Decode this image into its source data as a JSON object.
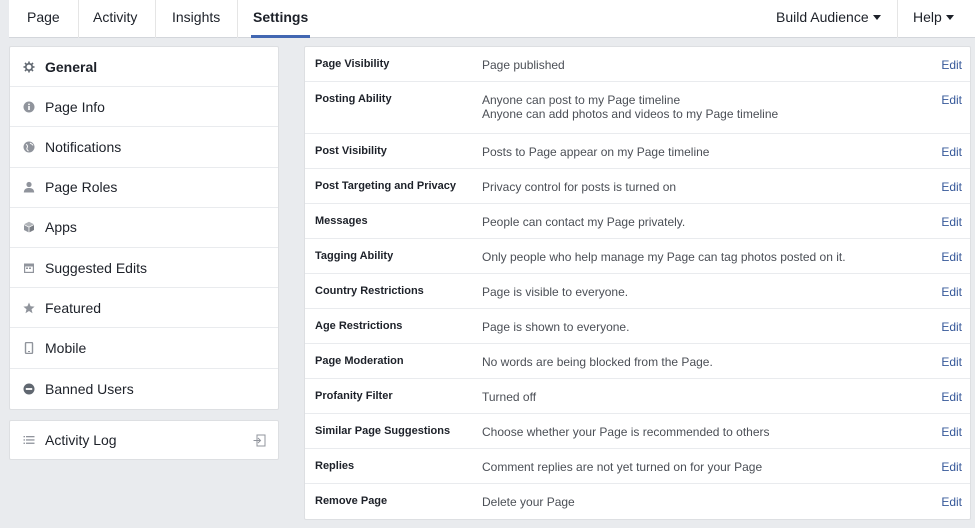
{
  "topnav": {
    "tabs": [
      {
        "label": "Page"
      },
      {
        "label": "Activity"
      },
      {
        "label": "Insights"
      },
      {
        "label": "Settings"
      }
    ],
    "build_audience": "Build Audience",
    "help": "Help"
  },
  "sidebar": {
    "items": [
      {
        "label": "General",
        "icon": "gear-icon"
      },
      {
        "label": "Page Info",
        "icon": "info-icon"
      },
      {
        "label": "Notifications",
        "icon": "globe-icon"
      },
      {
        "label": "Page Roles",
        "icon": "person-icon"
      },
      {
        "label": "Apps",
        "icon": "cube-icon"
      },
      {
        "label": "Suggested Edits",
        "icon": "calendar-icon"
      },
      {
        "label": "Featured",
        "icon": "star-icon"
      },
      {
        "label": "Mobile",
        "icon": "phone-icon"
      },
      {
        "label": "Banned Users",
        "icon": "minus-circle-icon"
      }
    ],
    "activity_log": "Activity Log"
  },
  "settings": {
    "edit_label": "Edit",
    "rows": [
      {
        "name": "Page Visibility",
        "value": "Page published"
      },
      {
        "name": "Posting Ability",
        "value": "Anyone can post to my Page timeline",
        "value2": "Anyone can add photos and videos to my Page timeline"
      },
      {
        "name": "Post Visibility",
        "value": "Posts to Page appear on my Page timeline"
      },
      {
        "name": "Post Targeting and Privacy",
        "value": "Privacy control for posts is turned on"
      },
      {
        "name": "Messages",
        "value": "People can contact my Page privately."
      },
      {
        "name": "Tagging Ability",
        "value": "Only people who help manage my Page can tag photos posted on it."
      },
      {
        "name": "Country Restrictions",
        "value": "Page is visible to everyone."
      },
      {
        "name": "Age Restrictions",
        "value": "Page is shown to everyone."
      },
      {
        "name": "Page Moderation",
        "value": "No words are being blocked from the Page."
      },
      {
        "name": "Profanity Filter",
        "value": "Turned off"
      },
      {
        "name": "Similar Page Suggestions",
        "value": "Choose whether your Page is recommended to others"
      },
      {
        "name": "Replies",
        "value": "Comment replies are not yet turned on for your Page"
      },
      {
        "name": "Remove Page",
        "value": "Delete your Page"
      }
    ]
  },
  "colors": {
    "accent": "#4267b2",
    "link": "#365899",
    "background": "#e9ebee"
  }
}
